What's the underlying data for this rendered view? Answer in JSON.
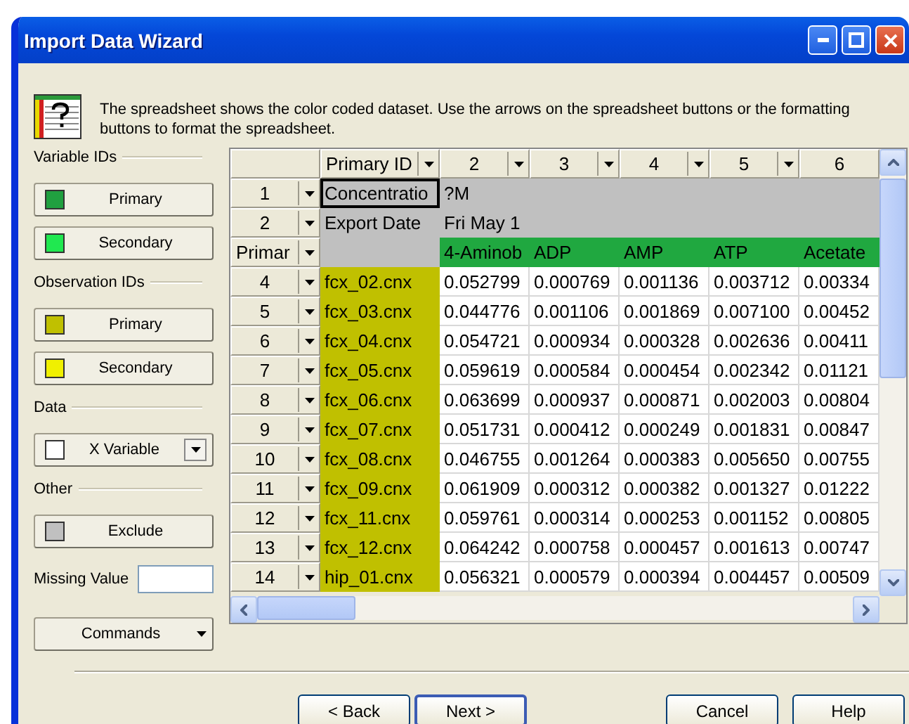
{
  "window": {
    "title": "Import Data Wizard"
  },
  "description": "The spreadsheet shows the color coded dataset. Use the arrows on the spreadsheet buttons or the formatting buttons to format the spreadsheet.",
  "groups": [
    {
      "label": "Variable IDs",
      "buttons": [
        {
          "label": "Primary",
          "color": "#20a040",
          "kind": "plain"
        },
        {
          "label": "Secondary",
          "color": "#20e850",
          "kind": "plain"
        }
      ]
    },
    {
      "label": "Observation IDs",
      "buttons": [
        {
          "label": "Primary",
          "color": "#c0c000",
          "kind": "plain"
        },
        {
          "label": "Secondary",
          "color": "#f0f000",
          "kind": "plain"
        }
      ]
    },
    {
      "label": "Data",
      "buttons": [
        {
          "label": "X Variable",
          "color": "#ffffff",
          "kind": "dropdown"
        }
      ]
    },
    {
      "label": "Other",
      "buttons": [
        {
          "label": "Exclude",
          "color": "#c0c0c0",
          "kind": "plain"
        }
      ]
    }
  ],
  "missing_value": {
    "label": "Missing Value"
  },
  "commands_button": "Commands",
  "table": {
    "columns": [
      {
        "label": "Primary ID",
        "kind": "id"
      },
      {
        "label": "2",
        "kind": "value"
      },
      {
        "label": "3",
        "kind": "value"
      },
      {
        "label": "4",
        "kind": "value"
      },
      {
        "label": "5",
        "kind": "value"
      },
      {
        "label": "6",
        "kind": "cut"
      }
    ],
    "rows": [
      {
        "header": "1",
        "kind": "info",
        "cells": [
          "Concentratio",
          "?M",
          "",
          "",
          "",
          ""
        ],
        "selected": [
          true,
          false,
          false,
          false,
          false,
          false
        ]
      },
      {
        "header": "2",
        "kind": "info",
        "cells": [
          "Export Date",
          "Fri May 1",
          "",
          "",
          "",
          ""
        ],
        "selected": [
          false,
          false,
          false,
          false,
          false,
          false
        ]
      },
      {
        "header": "Primar",
        "kind": "variables",
        "cells": [
          "",
          "4-Aminob",
          "ADP",
          "AMP",
          "ATP",
          "Acetate"
        ],
        "selected": [
          false,
          false,
          false,
          false,
          false,
          false
        ]
      },
      {
        "header": "4",
        "kind": "data",
        "cells": [
          "fcx_02.cnx",
          "0.052799",
          "0.000769",
          "0.001136",
          "0.003712",
          "0.00334"
        ],
        "selected": [
          false,
          false,
          false,
          false,
          false,
          false
        ]
      },
      {
        "header": "5",
        "kind": "data",
        "cells": [
          "fcx_03.cnx",
          "0.044776",
          "0.001106",
          "0.001869",
          "0.007100",
          "0.00452"
        ],
        "selected": [
          false,
          false,
          false,
          false,
          false,
          false
        ]
      },
      {
        "header": "6",
        "kind": "data",
        "cells": [
          "fcx_04.cnx",
          "0.054721",
          "0.000934",
          "0.000328",
          "0.002636",
          "0.00411"
        ],
        "selected": [
          false,
          false,
          false,
          false,
          false,
          false
        ]
      },
      {
        "header": "7",
        "kind": "data",
        "cells": [
          "fcx_05.cnx",
          "0.059619",
          "0.000584",
          "0.000454",
          "0.002342",
          "0.01121"
        ],
        "selected": [
          false,
          false,
          false,
          false,
          false,
          false
        ]
      },
      {
        "header": "8",
        "kind": "data",
        "cells": [
          "fcx_06.cnx",
          "0.063699",
          "0.000937",
          "0.000871",
          "0.002003",
          "0.00804"
        ],
        "selected": [
          false,
          false,
          false,
          false,
          false,
          false
        ]
      },
      {
        "header": "9",
        "kind": "data",
        "cells": [
          "fcx_07.cnx",
          "0.051731",
          "0.000412",
          "0.000249",
          "0.001831",
          "0.00847"
        ],
        "selected": [
          false,
          false,
          false,
          false,
          false,
          false
        ]
      },
      {
        "header": "10",
        "kind": "data",
        "cells": [
          "fcx_08.cnx",
          "0.046755",
          "0.001264",
          "0.000383",
          "0.005650",
          "0.00755"
        ],
        "selected": [
          false,
          false,
          false,
          false,
          false,
          false
        ]
      },
      {
        "header": "11",
        "kind": "data",
        "cells": [
          "fcx_09.cnx",
          "0.061909",
          "0.000312",
          "0.000382",
          "0.001327",
          "0.01222"
        ],
        "selected": [
          false,
          false,
          false,
          false,
          false,
          false
        ]
      },
      {
        "header": "12",
        "kind": "data",
        "cells": [
          "fcx_11.cnx",
          "0.059761",
          "0.000314",
          "0.000253",
          "0.001152",
          "0.00805"
        ],
        "selected": [
          false,
          false,
          false,
          false,
          false,
          false
        ]
      },
      {
        "header": "13",
        "kind": "data",
        "cells": [
          "fcx_12.cnx",
          "0.064242",
          "0.000758",
          "0.000457",
          "0.001613",
          "0.00747"
        ],
        "selected": [
          false,
          false,
          false,
          false,
          false,
          false
        ]
      },
      {
        "header": "14",
        "kind": "data",
        "cells": [
          "hip_01.cnx",
          "0.056321",
          "0.000579",
          "0.000394",
          "0.004457",
          "0.00509"
        ],
        "selected": [
          false,
          false,
          false,
          false,
          false,
          false
        ]
      }
    ]
  },
  "footer_buttons": [
    {
      "label": "< Back",
      "default": false
    },
    {
      "label": "Next >",
      "default": true
    },
    {
      "label": "Cancel",
      "default": false
    },
    {
      "label": "Help",
      "default": false
    }
  ]
}
